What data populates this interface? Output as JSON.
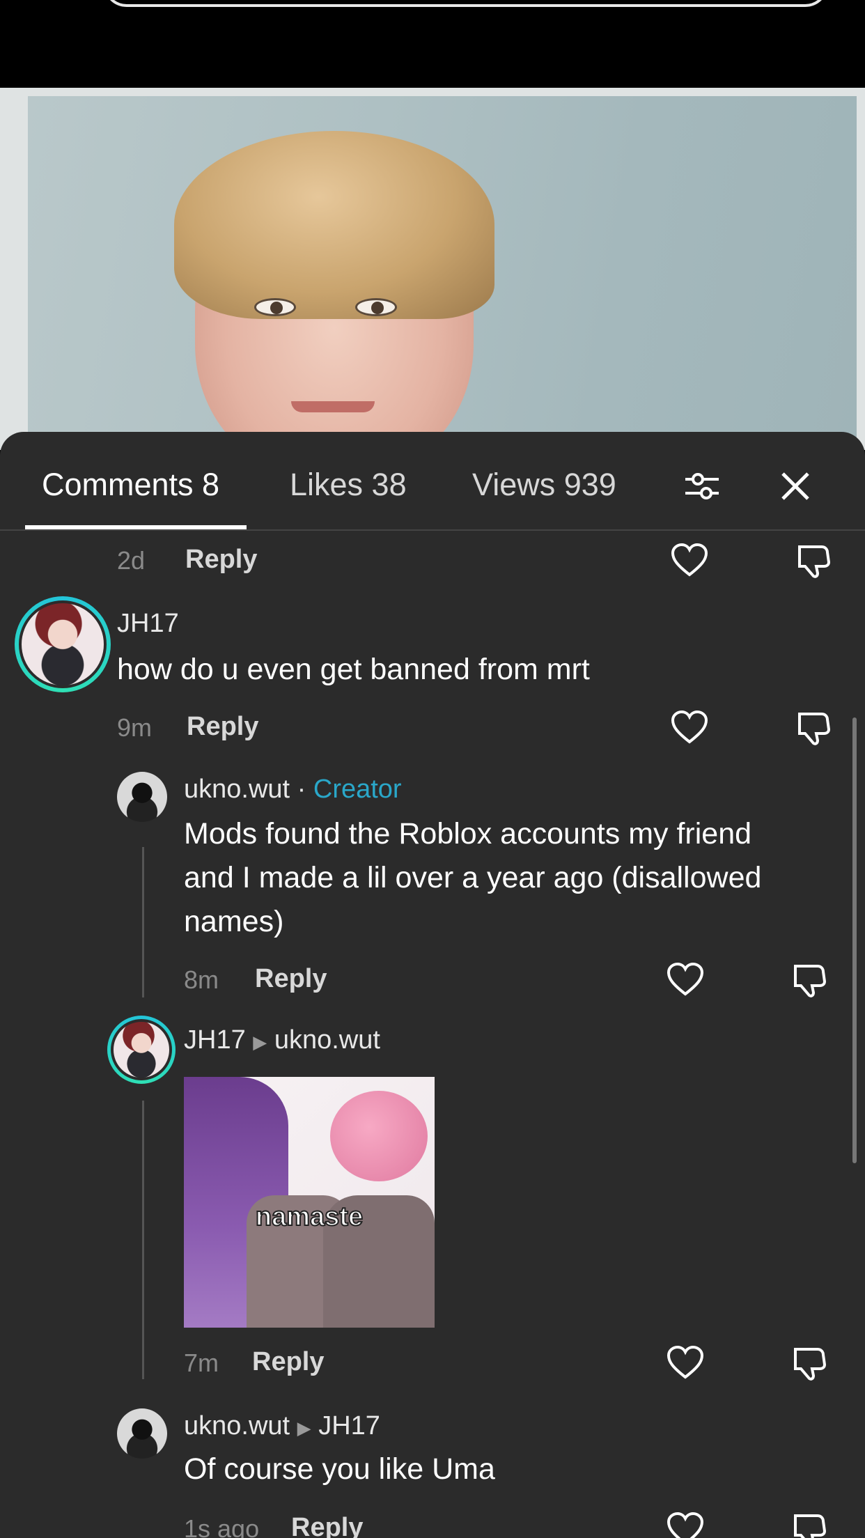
{
  "tabs": {
    "comments": "Comments 8",
    "likes": "Likes 38",
    "views": "Views 939"
  },
  "comments": [
    {
      "time": "2d",
      "reply": "Reply"
    },
    {
      "user": "JH17",
      "text": "how do u even get banned from mrt",
      "time": "9m",
      "reply": "Reply"
    },
    {
      "user": "ukno.wut",
      "separator": "·",
      "badge": "Creator",
      "text_lines": [
        "Mods found the Roblox accounts my friend",
        "and I made a lil over a year ago (disallowed",
        "names)"
      ],
      "time": "8m",
      "reply": "Reply"
    },
    {
      "user": "JH17",
      "reply_to": "ukno.wut",
      "image_caption": "namaste",
      "time": "7m",
      "reply": "Reply"
    },
    {
      "user": "ukno.wut",
      "reply_to": "JH17",
      "text": "Of course you like Uma",
      "time": "1s ago",
      "reply": "Reply"
    }
  ],
  "colors": {
    "sheet_bg": "#2b2b2b",
    "creator_accent": "#2aa7c9",
    "avatar_ring": "#23c4d9"
  },
  "icons": [
    "filter-sliders-icon",
    "close-icon",
    "heart-icon",
    "dislike-icon",
    "play-arrow-icon"
  ]
}
